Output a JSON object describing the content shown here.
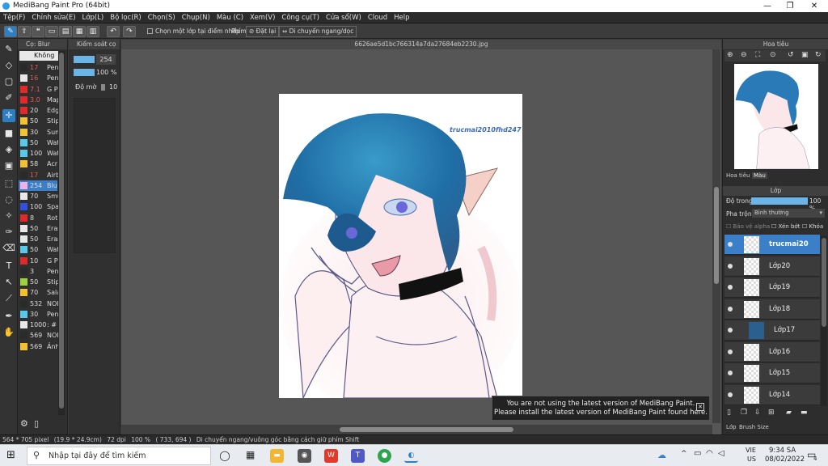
{
  "window": {
    "title": "MediBang Paint Pro (64bit)"
  },
  "menu": [
    "Tệp(F)",
    "Chỉnh sửa(E)",
    "Lớp(L)",
    "Bộ lọc(R)",
    "Chọn(S)",
    "Chụp(N)",
    "Màu (C)",
    "Xem(V)",
    "Công cụ(T)",
    "Cửa sổ(W)",
    "Cloud",
    "Help"
  ],
  "toolbar": {
    "snap_checkbox": "Chọn một lớp tại điểm nhấp",
    "phim_label": "Phím",
    "reset_label": "Đặt lại",
    "flip_label": "Di chuyển ngang/dọc"
  },
  "brush_panel": {
    "title": "Cọ: Blur",
    "selected_label": "Không c",
    "brushes": [
      {
        "size": "17",
        "name": "Pen",
        "color": "#2a2a2a",
        "size_color": "#e05a5a"
      },
      {
        "size": "16",
        "name": "Pen",
        "color": "#e8e8e8",
        "size_color": "#e05a5a"
      },
      {
        "size": "7.1",
        "name": "G P",
        "color": "#e02a2a",
        "size_color": "#e05a5a"
      },
      {
        "size": "3.0",
        "name": "Map",
        "color": "#e02a2a",
        "size_color": "#e05a5a"
      },
      {
        "size": "20",
        "name": "Edg",
        "color": "#e02a2a",
        "size_color": "#dddddd"
      },
      {
        "size": "50",
        "name": "Stip",
        "color": "#f2c230",
        "size_color": "#dddddd"
      },
      {
        "size": "30",
        "name": "Sun",
        "color": "#f2c230",
        "size_color": "#dddddd"
      },
      {
        "size": "50",
        "name": "Wat",
        "color": "#5ac8e8",
        "size_color": "#dddddd"
      },
      {
        "size": "100",
        "name": "Wat",
        "color": "#5ac8e8",
        "size_color": "#dddddd"
      },
      {
        "size": "58",
        "name": "Acr",
        "color": "#f2c230",
        "size_color": "#dddddd"
      },
      {
        "size": "17",
        "name": "Airb",
        "color": "#2a2a2a",
        "size_color": "#e05a5a"
      },
      {
        "size": "254",
        "name": "Blu",
        "color": "#f0b0e8",
        "size_color": "#dddddd"
      },
      {
        "size": "70",
        "name": "Smu",
        "color": "#e8e8e8",
        "size_color": "#dddddd"
      },
      {
        "size": "100",
        "name": "Spa",
        "color": "#3050e0",
        "size_color": "#dddddd"
      },
      {
        "size": "8",
        "name": "Rot",
        "color": "#e02a2a",
        "size_color": "#dddddd"
      },
      {
        "size": "50",
        "name": "Eras",
        "color": "#e8e8e8",
        "size_color": "#dddddd"
      },
      {
        "size": "50",
        "name": "Eras",
        "color": "#e8e8e8",
        "size_color": "#dddddd"
      },
      {
        "size": "50",
        "name": "Wat",
        "color": "#5ac8e8",
        "size_color": "#dddddd"
      },
      {
        "size": "10",
        "name": "G P",
        "color": "#e02a2a",
        "size_color": "#dddddd"
      },
      {
        "size": "3",
        "name": "Pen",
        "color": "#2a2a2a",
        "size_color": "#dddddd"
      },
      {
        "size": "50",
        "name": "Stip",
        "color": "#a0d040",
        "size_color": "#dddddd"
      },
      {
        "size": "70",
        "name": "Sala",
        "color": "#f2c230",
        "size_color": "#dddddd"
      },
      {
        "size": "532",
        "name": "NOI",
        "color": "#2a2a2a",
        "size_color": "#dddddd"
      },
      {
        "size": "30",
        "name": "Pen",
        "color": "#5ac8e8",
        "size_color": "#dddddd"
      },
      {
        "size": "1000",
        "name": ": #",
        "color": "#e8e8e8",
        "size_color": "#dddddd"
      },
      {
        "size": "569",
        "name": "NOI",
        "color": "#2a2a2a",
        "size_color": "#dddddd"
      },
      {
        "size": "569",
        "name": "Ảnh",
        "color": "#f2c230",
        "size_color": "#dddddd"
      }
    ]
  },
  "control_panel": {
    "title": "Kiểm soát cọ",
    "size_value": "254",
    "opacity_value": "100 %",
    "density_label": "Độ mờ",
    "density_value": "10"
  },
  "canvas": {
    "filename": "6626ae5d1bc766314a7da27684eb2230.jpg",
    "watermark": "trucmai2010fhd247"
  },
  "notification": {
    "line1": "You are not using the latest version of MediBang Paint.",
    "line2": "Please install the latest version of MediBang Paint found here."
  },
  "navigator": {
    "title": "Hoa tiêu",
    "tabs": [
      "Hoa tiêu",
      "Màu"
    ]
  },
  "layers_panel": {
    "title": "Lớp",
    "opacity_label": "Độ trong",
    "opacity_value": "100 %",
    "opacity_level": 1.0,
    "blend_label": "Pha trộn",
    "blend_value": "Bình thường",
    "protect_alpha": "Bảo vệ alpha",
    "clipping": "Xén bớt",
    "lock": "Khóa",
    "layers": [
      "trucmai20",
      "Lớp20",
      "Lớp19",
      "Lớp18",
      "Lớp17",
      "Lớp16",
      "Lớp15",
      "Lớp14"
    ],
    "bottom_tabs": [
      "Lớp",
      "Brush Size"
    ]
  },
  "statusbar": {
    "size": "564 * 705 pixel",
    "cm": "(19.9 * 24.9cm)",
    "dpi": "72 dpi",
    "zoom": "100 %",
    "coords": "( 733, 694 )",
    "hint": "Di chuyển ngang/vuông góc bằng cách giữ phím Shift"
  },
  "taskbar": {
    "search_placeholder": "Nhập tại đây để tìm kiếm",
    "lang1": "VIE",
    "lang2": "US",
    "time": "9:34 SA",
    "date": "08/02/2022",
    "notifications": "4"
  }
}
